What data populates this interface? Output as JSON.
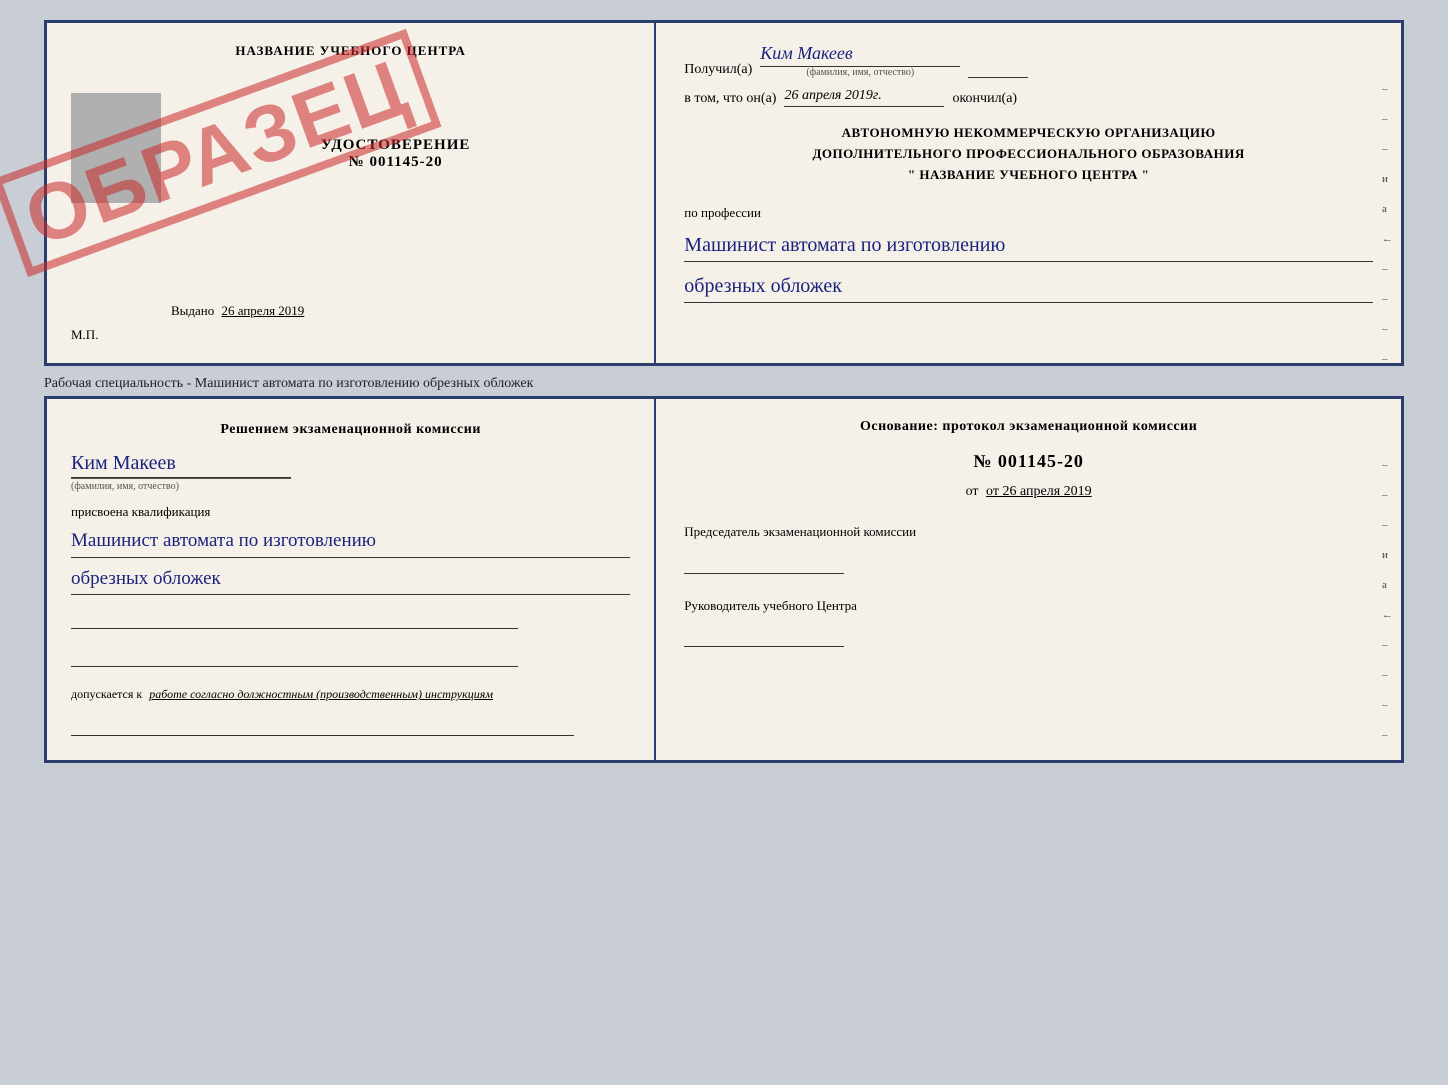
{
  "top_document": {
    "left": {
      "school_name": "НАЗВАНИЕ УЧЕБНОГО ЦЕНТРА",
      "cert_title": "УДОСТОВЕРЕНИЕ",
      "cert_number": "№ 001145-20",
      "stamp": "ОБРАЗЕЦ",
      "issued_label": "Выдано",
      "issued_date": "26 апреля 2019",
      "mp_label": "М.П."
    },
    "right": {
      "recipient_label": "Получил(а)",
      "recipient_name": "Ким Макеев",
      "name_hint": "(фамилия, имя, отчество)",
      "date_prefix": "в том, что он(а)",
      "date_value": "26 апреля 2019г.",
      "date_suffix": "окончил(а)",
      "org_line1": "АВТОНОМНУЮ НЕКОММЕРЧЕСКУЮ ОРГАНИЗАЦИЮ",
      "org_line2": "ДОПОЛНИТЕЛЬНОГО ПРОФЕССИОНАЛЬНОГО ОБРАЗОВАНИЯ",
      "org_line3": "\"   НАЗВАНИЕ УЧЕБНОГО ЦЕНТРА   \"",
      "profession_label": "по профессии",
      "profession_handwritten_line1": "Машинист автомата по изготовлению",
      "profession_handwritten_line2": "обрезных обложек",
      "right_marks": [
        "–",
        "–",
        "–",
        "и",
        "а",
        "←",
        "–",
        "–",
        "–",
        "–"
      ]
    }
  },
  "caption": {
    "text": "Рабочая специальность - Машинист автомата по изготовлению обрезных обложек"
  },
  "bottom_document": {
    "left": {
      "komissia_line1": "Решением  экзаменационной  комиссии",
      "person_name": "Ким Макеев",
      "name_hint": "(фамилия, имя, отчество)",
      "qualification_label": "присвоена квалификация",
      "profession_line1": "Машинист автомата по изготовлению",
      "profession_line2": "обрезных обложек",
      "допускается_prefix": "допускается к",
      "допускается_text": "работе согласно должностным (производственным) инструкциям"
    },
    "right": {
      "osnov_label": "Основание: протокол экзаменационной  комиссии",
      "protocol_number": "№  001145-20",
      "date_ot": "от 26 апреля 2019",
      "chairman_label": "Председатель экзаменационной комиссии",
      "head_label": "Руководитель учебного Центра",
      "right_marks": [
        "–",
        "–",
        "–",
        "и",
        "а",
        "←",
        "–",
        "–",
        "–",
        "–"
      ]
    }
  }
}
